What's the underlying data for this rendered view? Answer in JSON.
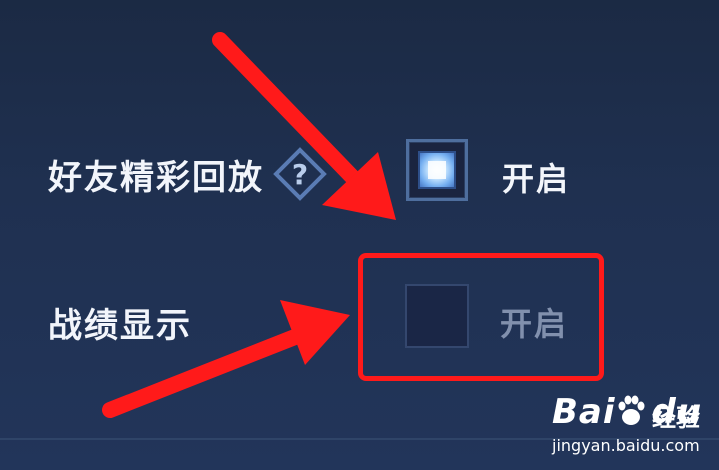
{
  "settings": {
    "rows": [
      {
        "label": "好友精彩回放",
        "option_text": "开启",
        "checked": true,
        "has_help_icon": true
      },
      {
        "label": "战绩显示",
        "option_text": "开启",
        "checked": false,
        "has_help_icon": false
      }
    ]
  },
  "icons": {
    "help": "question-diamond-icon",
    "arrow": "red-arrow-icon",
    "paw": "baidu-paw-icon"
  },
  "colors": {
    "background": "#1f3050",
    "label_text": "#f2f5fb",
    "disabled_text": "#8190ad",
    "highlight": "#ff1a1a",
    "checked_fill": "#c8e6ff"
  },
  "watermark": {
    "logo_text": "Bai",
    "logo_suffix": "du",
    "cn_text": "经验",
    "url": "jingyan.baidu.com"
  }
}
